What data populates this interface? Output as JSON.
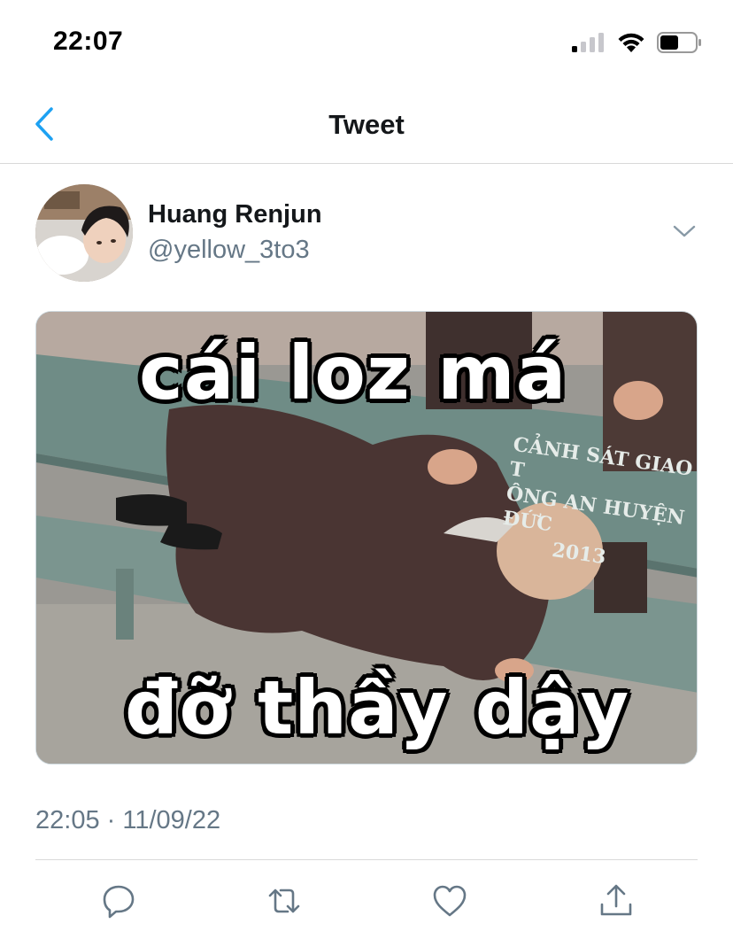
{
  "status_bar": {
    "time": "22:07",
    "icons": [
      "signal-icon",
      "wifi-icon",
      "battery-icon"
    ]
  },
  "nav": {
    "title": "Tweet",
    "back_icon": "chevron-left-icon"
  },
  "tweet": {
    "author_name": "Huang Renjun",
    "author_handle": "@yellow_3to3",
    "media": {
      "caption_top": "cái loz má",
      "caption_bottom": "đỡ thầy dậy",
      "sign_line1": "CẢNH SÁT GIAO T",
      "sign_line2": "ÔNG AN HUYỆN ĐỨC",
      "sign_line3": "2013"
    },
    "timestamp": "22:05 · 11/09/22"
  },
  "actions": [
    "reply-icon",
    "retweet-icon",
    "like-icon",
    "share-icon"
  ],
  "colors": {
    "accent": "#1da1f2",
    "secondary_text": "#657786",
    "divider": "#d9d9d9"
  }
}
